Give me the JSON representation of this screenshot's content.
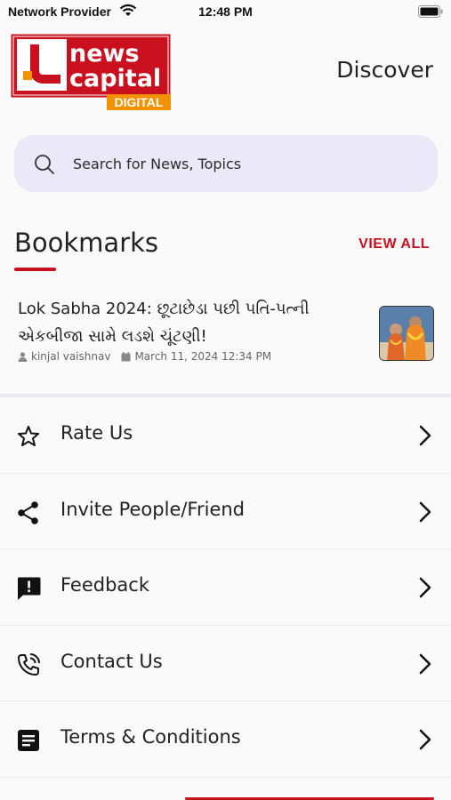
{
  "status_bar": {
    "carrier": "Network Provider",
    "time": "12:48 PM"
  },
  "header": {
    "logo_text_line1": "news",
    "logo_text_line2": "capital",
    "logo_badge": "DIGITAL",
    "discover_label": "Discover"
  },
  "search": {
    "placeholder": "Search for News, Topics"
  },
  "bookmarks": {
    "title": "Bookmarks",
    "view_all": "VIEW ALL",
    "items": [
      {
        "title": "Lok Sabha 2024: છૂટાછેડા પછી પતિ-પત્ની એકબીજા સામે લડશે ચૂંટણી!",
        "author": "kinjal vaishnav",
        "date": "March 11, 2024 12:34 PM"
      }
    ]
  },
  "menu": [
    {
      "label": "Rate Us",
      "icon": "star-icon"
    },
    {
      "label": "Invite People/Friend",
      "icon": "share-icon"
    },
    {
      "label": "Feedback",
      "icon": "feedback-icon"
    },
    {
      "label": "Contact Us",
      "icon": "phone-icon"
    },
    {
      "label": "Terms & Conditions",
      "icon": "document-icon"
    }
  ],
  "colors": {
    "brand_red": "#c8101f",
    "brand_orange": "#f39200",
    "search_bg": "#ebe8f7"
  }
}
